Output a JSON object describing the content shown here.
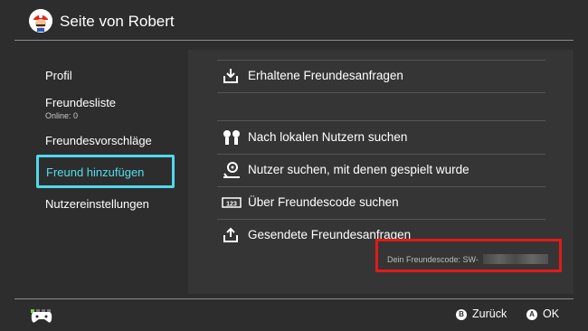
{
  "header": {
    "title": "Seite von Robert",
    "avatar": "mario-avatar"
  },
  "sidebar": {
    "items": [
      {
        "label": "Profil"
      },
      {
        "label": "Freundesliste",
        "sub": "Online: 0"
      },
      {
        "label": "Freundesvorschläge"
      },
      {
        "label": "Freund hinzufügen",
        "selected": true
      },
      {
        "label": "Nutzereinstellungen"
      }
    ]
  },
  "main": {
    "items": [
      {
        "label": "Erhaltene Freundesanfragen",
        "icon": "inbox-download-icon"
      },
      {
        "label": "Nach lokalen Nutzern suchen",
        "icon": "local-users-icon"
      },
      {
        "label": "Nutzer suchen, mit denen gespielt wurde",
        "icon": "played-users-icon"
      },
      {
        "label": "Über Freundescode suchen",
        "icon": "friend-code-icon"
      },
      {
        "label": "Gesendete Freundesanfragen",
        "icon": "outbox-upload-icon"
      }
    ],
    "friend_code": "Dein Freundescode: SW-"
  },
  "footer": {
    "back": {
      "key": "B",
      "label": "Zurück"
    },
    "ok": {
      "key": "A",
      "label": "OK"
    }
  },
  "colors": {
    "accent": "#4fd9ea",
    "highlight_box": "#e11a1a",
    "page_bg": "#2d2d2d",
    "panel_bg": "#353535"
  }
}
